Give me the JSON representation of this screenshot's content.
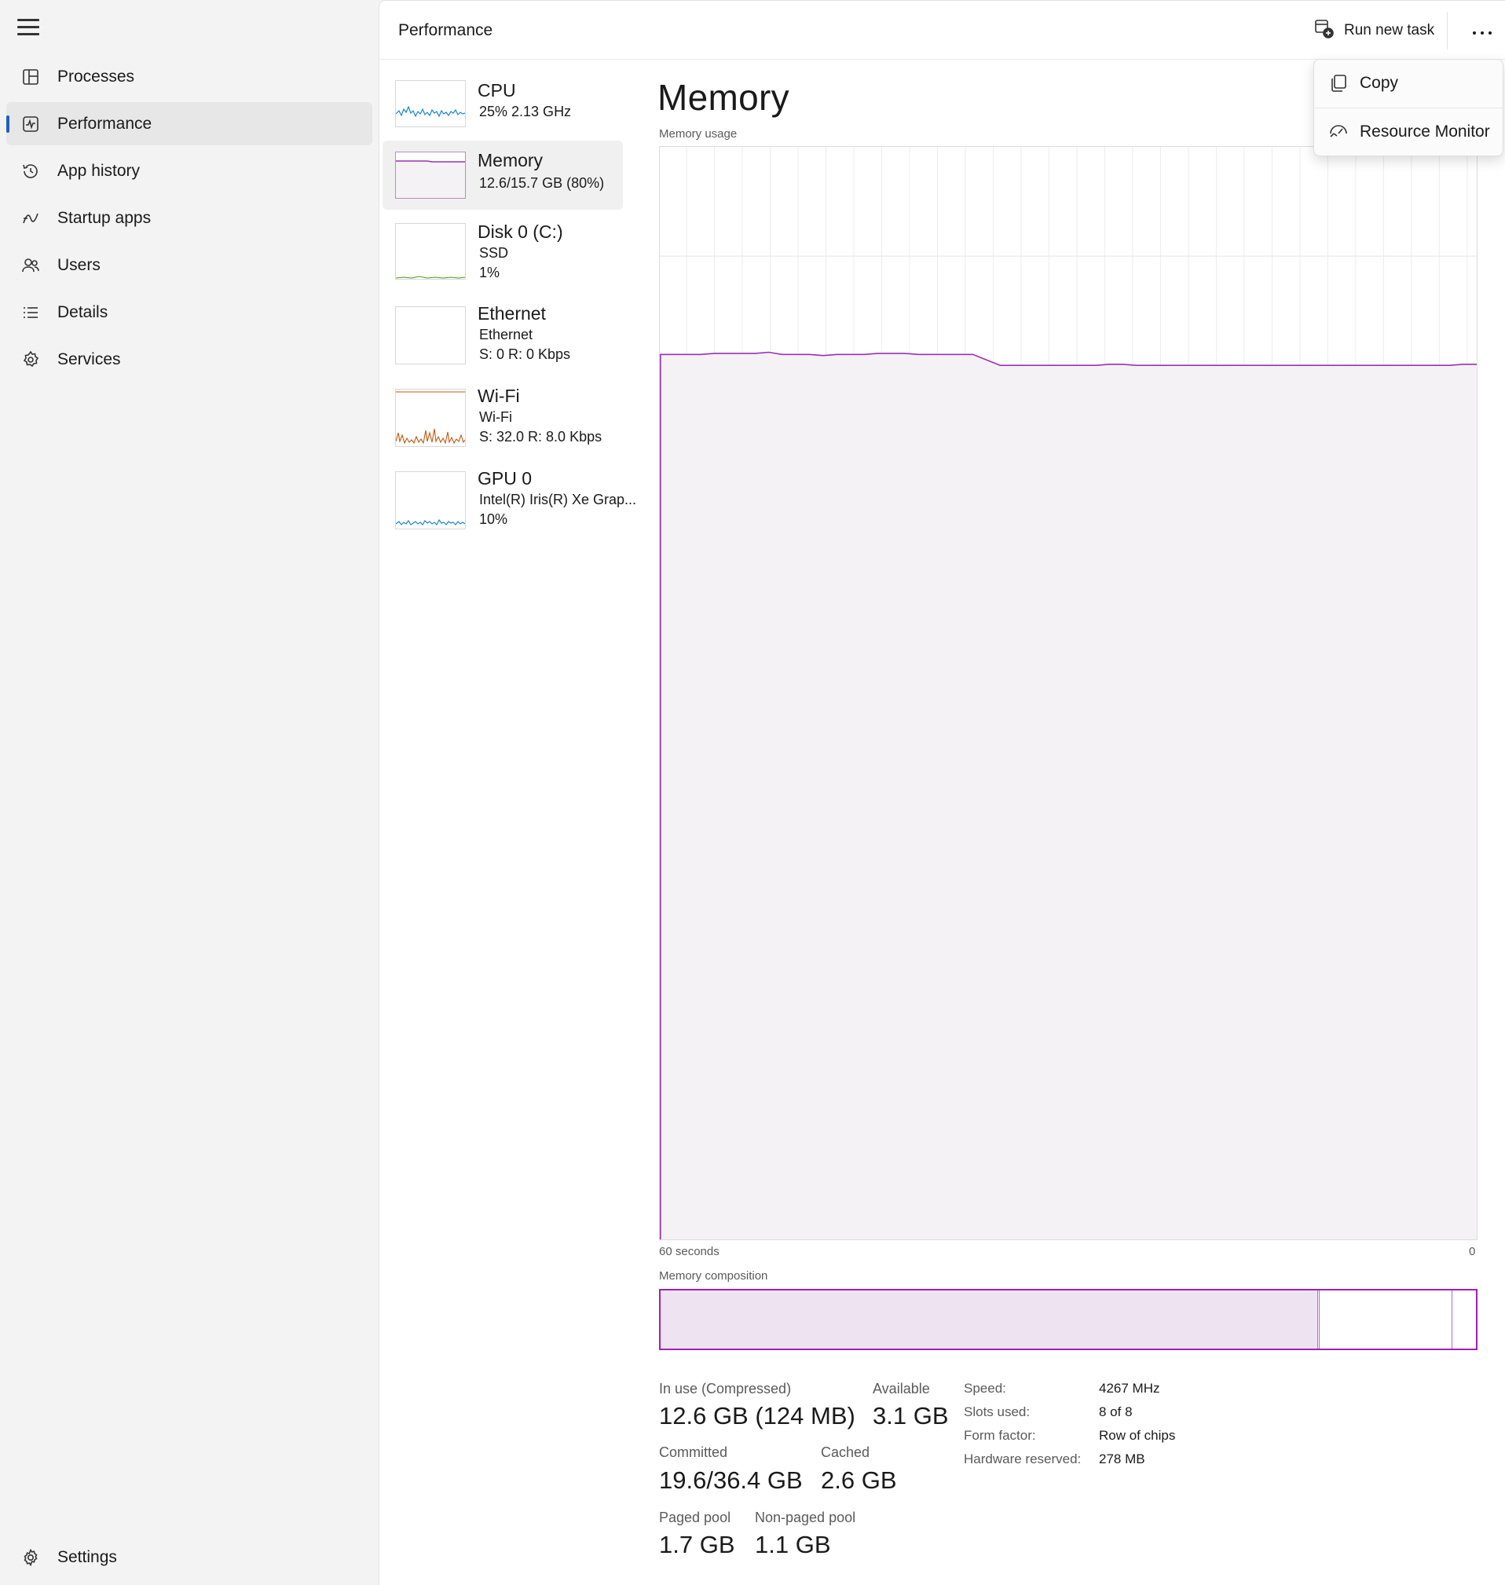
{
  "sidebar": {
    "items": [
      {
        "label": "Processes",
        "icon": "processes-icon",
        "active": false
      },
      {
        "label": "Performance",
        "icon": "performance-icon",
        "active": true
      },
      {
        "label": "App history",
        "icon": "app-history-icon",
        "active": false
      },
      {
        "label": "Startup apps",
        "icon": "startup-apps-icon",
        "active": false
      },
      {
        "label": "Users",
        "icon": "users-icon",
        "active": false
      },
      {
        "label": "Details",
        "icon": "details-icon",
        "active": false
      },
      {
        "label": "Services",
        "icon": "services-icon",
        "active": false
      }
    ],
    "settings_label": "Settings"
  },
  "header": {
    "title": "Performance",
    "run_new_task_label": "Run new task"
  },
  "menu": {
    "items": [
      {
        "label": "Copy",
        "icon": "copy-icon"
      },
      {
        "label": "Resource Monitor",
        "icon": "resource-monitor-icon"
      }
    ]
  },
  "resources": [
    {
      "name": "CPU",
      "sub1": "25%  2.13 GHz",
      "sub2": "",
      "color": "#1b86d2"
    },
    {
      "name": "Memory",
      "sub1": "12.6/15.7 GB (80%)",
      "sub2": "",
      "color": "#9b30b4"
    },
    {
      "name": "Disk 0 (C:)",
      "sub1": "SSD",
      "sub2": "1%",
      "color": "#4e9a06"
    },
    {
      "name": "Ethernet",
      "sub1": "Ethernet",
      "sub2": "S: 0  R: 0 Kbps",
      "color": "#c05a12"
    },
    {
      "name": "Wi-Fi",
      "sub1": "Wi-Fi",
      "sub2": "S: 32.0  R: 8.0 Kbps",
      "color": "#c05a12"
    },
    {
      "name": "GPU 0",
      "sub1": "Intel(R) Iris(R) Xe Grap...",
      "sub2": "10%",
      "color": "#1b86d2"
    }
  ],
  "detail": {
    "title": "Memory",
    "chart_caption": "Memory usage",
    "axis_left": "60 seconds",
    "axis_right": "0",
    "composition_caption": "Memory composition",
    "composition": {
      "in_use_fraction": 0.805,
      "modified_fraction": 0.003,
      "standby_fraction": 0.163,
      "free_fraction": 0.029
    },
    "stats": {
      "in_use_label": "In use (Compressed)",
      "in_use_value": "12.6 GB (124 MB)",
      "available_label": "Available",
      "available_value": "3.1 GB",
      "committed_label": "Committed",
      "committed_value": "19.6/36.4 GB",
      "cached_label": "Cached",
      "cached_value": "2.6 GB",
      "paged_pool_label": "Paged pool",
      "paged_pool_value": "1.7 GB",
      "nonpaged_pool_label": "Non-paged pool",
      "nonpaged_pool_value": "1.1 GB"
    },
    "specs": [
      {
        "label": "Speed:",
        "value": "4267 MHz"
      },
      {
        "label": "Slots used:",
        "value": "8 of 8"
      },
      {
        "label": "Form factor:",
        "value": "Row of chips"
      },
      {
        "label": "Hardware reserved:",
        "value": "278 MB"
      }
    ]
  },
  "chart_data": {
    "type": "area",
    "title": "Memory usage",
    "xlabel": "",
    "ylabel": "",
    "x_range_seconds": [
      60,
      0
    ],
    "ylim_percent": [
      0,
      100
    ],
    "grid": true,
    "series": [
      {
        "values": [
          81,
          81,
          81,
          81,
          81.1,
          81.1,
          81.1,
          81.1,
          81.2,
          81,
          81,
          81,
          80.9,
          81,
          81,
          81,
          81.1,
          81.1,
          81.1,
          81,
          81,
          81,
          81,
          81,
          80.5,
          80,
          80,
          80,
          80,
          80,
          80,
          80,
          80,
          80.1,
          80.1,
          80,
          80,
          80,
          80,
          80,
          80,
          80,
          80,
          80,
          80,
          80,
          80,
          80,
          80,
          80,
          80,
          80,
          80,
          80,
          80,
          80,
          80,
          80,
          80,
          80.1,
          80.1
        ]
      }
    ],
    "line_color": "#9b30b4",
    "fill_color": "#f4f2f5"
  }
}
